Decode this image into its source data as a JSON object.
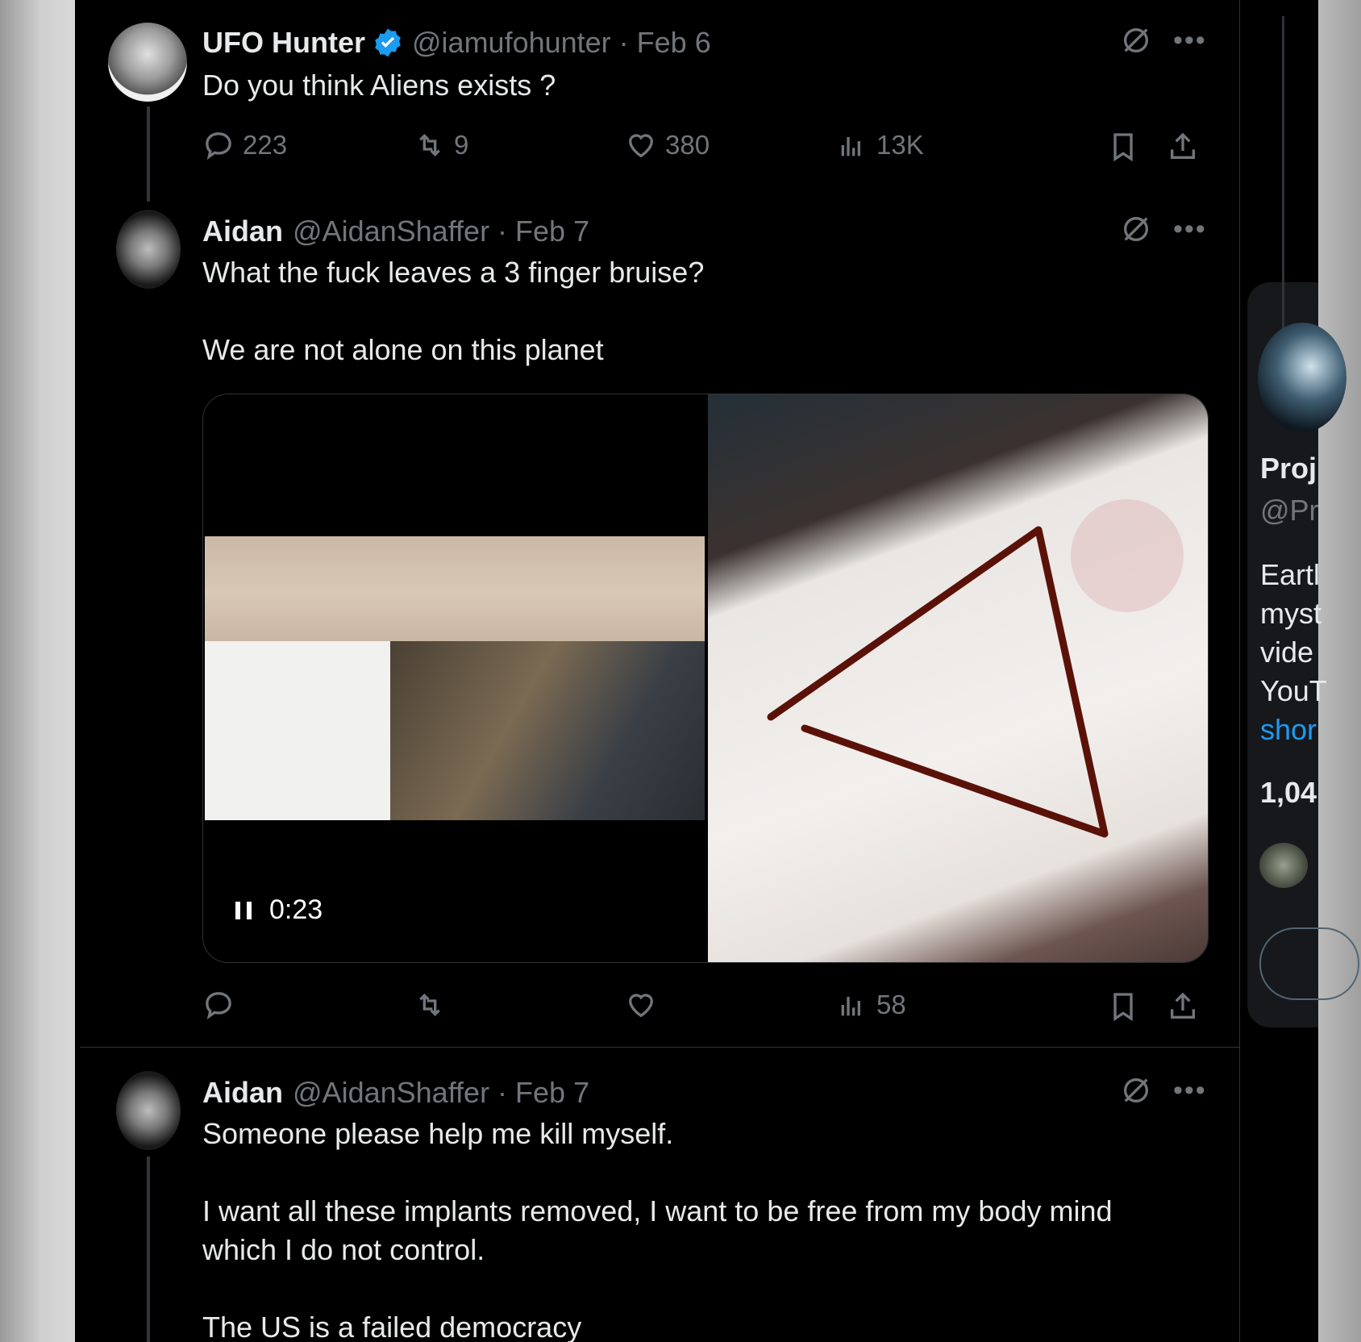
{
  "tweets": [
    {
      "name": "UFO Hunter",
      "verified": true,
      "handle": "@iamufohunter · Feb 6",
      "text": "Do you think Aliens exists ?",
      "stats": {
        "replies": "223",
        "reposts": "9",
        "likes": "380",
        "views": "13K"
      }
    },
    {
      "name": "Aidan",
      "handle": "@AidanShaffer · Feb 7",
      "text": "What the fuck leaves a 3 finger bruise?\n\nWe are not alone on this planet",
      "video_time": "0:23",
      "stats": {
        "views": "58"
      }
    },
    {
      "name": "Aidan",
      "handle": "@AidanShaffer · Feb 7",
      "text": "Someone please help me kill myself.\n\nI want all these implants removed, I want to be free from my body mind\nwhich I do not control.\n\nThe US is a failed democracy"
    }
  ],
  "sidebar": {
    "title": "Proj",
    "handle": "@Pr",
    "lines": [
      "Eartl",
      "myst",
      "vide",
      "YouT"
    ],
    "link": "shor",
    "count": "1,04"
  },
  "colors": {
    "accent": "#1d9bf0",
    "muted": "#71767b",
    "text": "#e7e9ea",
    "background": "#000000"
  }
}
